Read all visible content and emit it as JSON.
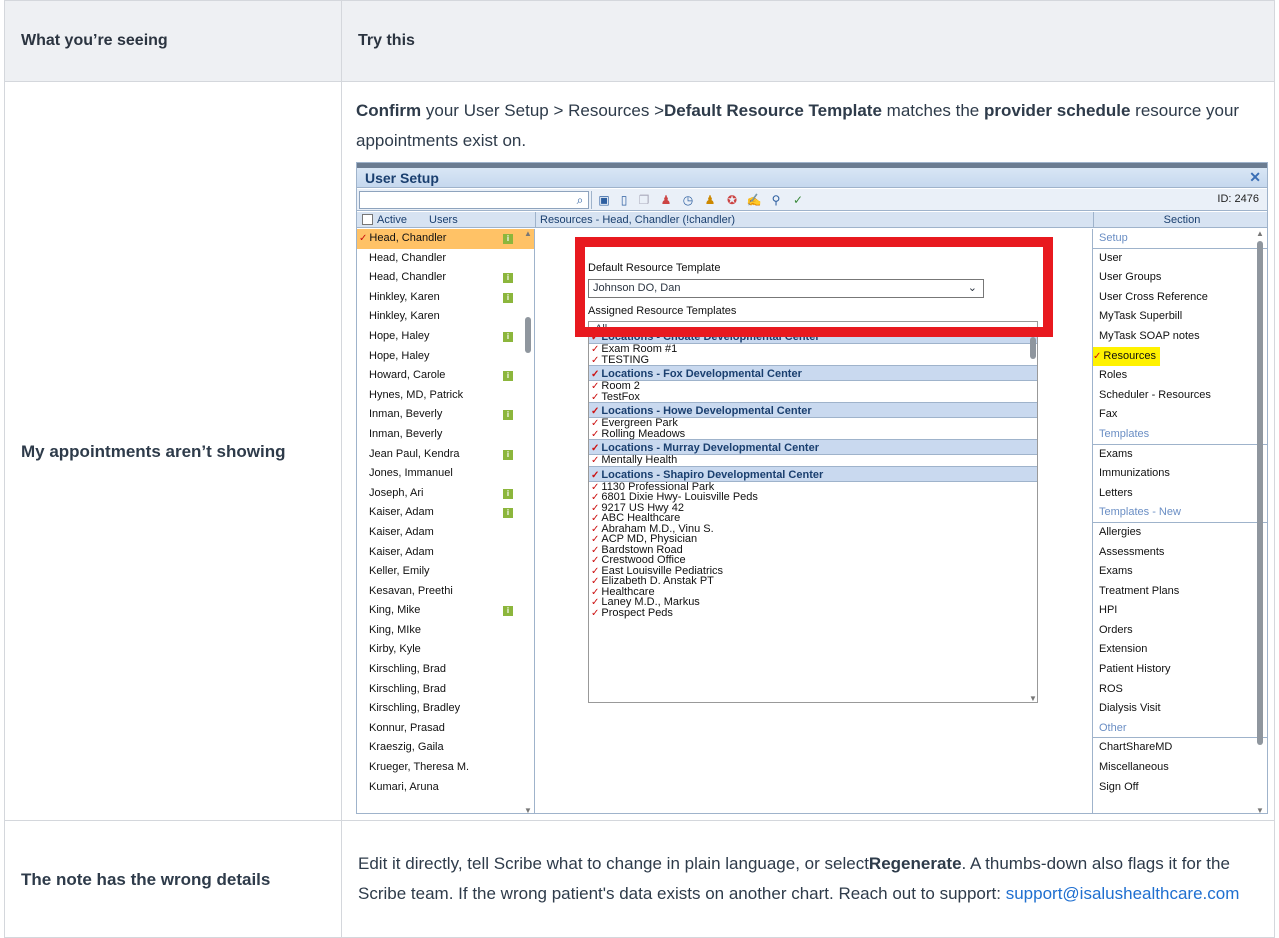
{
  "table": {
    "header_left": "What you’re seeing",
    "header_right": "Try this"
  },
  "row1": {
    "left": "My appointments aren’t showing",
    "right_parts": {
      "p1": "Confirm",
      "p2": " your User Setup > Resources >",
      "p3": "Default Resource Template",
      "p4": " matches the ",
      "p5": "provider schedule",
      "p6": " resource your appointments exist on."
    }
  },
  "row2": {
    "left": "The note has the wrong details",
    "p1": "Edit it directly, tell Scribe what to change in plain language, or select",
    "p2": "Regenerate",
    "p3": ". A thumbs-down also flags it for the Scribe team. If the wrong patient's data exists on another chart. Reach out to support: ",
    "link": "support@isalushealthcare.com"
  },
  "app": {
    "title": "User Setup",
    "id_label": "ID: 2476",
    "col_active": "Active",
    "col_users": "Users",
    "col_resources": "Resources - Head, Chandler (!chandler)",
    "col_section": "Section",
    "default_label": "Default Resource Template",
    "default_value": "Johnson DO, Dan",
    "assigned_label": "Assigned Resource Templates",
    "assigned_value": "All",
    "users": [
      {
        "name": "Head, Chandler",
        "info": true,
        "selected": true
      },
      {
        "name": "Head, Chandler",
        "info": false
      },
      {
        "name": "Head, Chandler",
        "info": true
      },
      {
        "name": "Hinkley, Karen",
        "info": true
      },
      {
        "name": "Hinkley, Karen",
        "info": false
      },
      {
        "name": "Hope, Haley",
        "info": true
      },
      {
        "name": "Hope, Haley",
        "info": false
      },
      {
        "name": "Howard, Carole",
        "info": true
      },
      {
        "name": "Hynes, MD, Patrick",
        "info": false
      },
      {
        "name": "Inman, Beverly",
        "info": true
      },
      {
        "name": "Inman, Beverly",
        "info": false
      },
      {
        "name": "Jean Paul, Kendra",
        "info": true
      },
      {
        "name": "Jones, Immanuel",
        "info": false
      },
      {
        "name": "Joseph, Ari",
        "info": true
      },
      {
        "name": "Kaiser, Adam",
        "info": true
      },
      {
        "name": "Kaiser, Adam",
        "info": false
      },
      {
        "name": "Kaiser, Adam",
        "info": false
      },
      {
        "name": "Keller, Emily",
        "info": false
      },
      {
        "name": "Kesavan, Preethi",
        "info": false
      },
      {
        "name": "King, Mike",
        "info": true
      },
      {
        "name": "King, MIke",
        "info": false
      },
      {
        "name": "Kirby, Kyle",
        "info": false
      },
      {
        "name": "Kirschling, Brad",
        "info": false
      },
      {
        "name": "Kirschling, Brad",
        "info": false
      },
      {
        "name": "Kirschling, Bradley",
        "info": false
      },
      {
        "name": "Konnur, Prasad",
        "info": false
      },
      {
        "name": "Kraeszig, Gaila",
        "info": false
      },
      {
        "name": "Krueger, Theresa M.",
        "info": false
      },
      {
        "name": "Kumari, Aruna",
        "info": false
      }
    ],
    "resources": [
      {
        "t": "grp",
        "text": "Locations - Choate Developmental Center"
      },
      {
        "t": "it",
        "text": "Exam Room #1"
      },
      {
        "t": "it",
        "text": "TESTING"
      },
      {
        "t": "grp",
        "text": "Locations - Fox Developmental Center"
      },
      {
        "t": "it",
        "text": "Room 2"
      },
      {
        "t": "it",
        "text": "TestFox"
      },
      {
        "t": "grp",
        "text": "Locations - Howe Developmental Center"
      },
      {
        "t": "it",
        "text": "Evergreen Park"
      },
      {
        "t": "it",
        "text": "Rolling Meadows"
      },
      {
        "t": "grp",
        "text": "Locations - Murray Developmental Center"
      },
      {
        "t": "it",
        "text": "Mentally Health"
      },
      {
        "t": "grp",
        "text": "Locations - Shapiro Developmental Center"
      },
      {
        "t": "it",
        "text": "1130 Professional Park"
      },
      {
        "t": "it",
        "text": "6801 Dixie Hwy- Louisville Peds"
      },
      {
        "t": "it",
        "text": "9217 US Hwy 42"
      },
      {
        "t": "it",
        "text": "ABC Healthcare"
      },
      {
        "t": "it",
        "text": "Abraham M.D., Vinu S."
      },
      {
        "t": "it",
        "text": "ACP MD, Physician"
      },
      {
        "t": "it",
        "text": "Bardstown Road"
      },
      {
        "t": "it",
        "text": "Crestwood Office"
      },
      {
        "t": "it",
        "text": "East Louisville Pediatrics"
      },
      {
        "t": "it",
        "text": "Elizabeth D. Anstak PT"
      },
      {
        "t": "it",
        "text": "Healthcare"
      },
      {
        "t": "it",
        "text": "Laney M.D., Markus"
      },
      {
        "t": "it",
        "text": "Prospect Peds"
      }
    ],
    "sections": [
      {
        "t": "h",
        "text": "Setup"
      },
      {
        "t": "s",
        "text": "User"
      },
      {
        "t": "s",
        "text": "User Groups"
      },
      {
        "t": "s",
        "text": "User Cross Reference"
      },
      {
        "t": "s",
        "text": "MyTask Superbill"
      },
      {
        "t": "s",
        "text": "MyTask SOAP notes"
      },
      {
        "t": "sel",
        "text": "Resources"
      },
      {
        "t": "s",
        "text": "Roles"
      },
      {
        "t": "s",
        "text": "Scheduler - Resources"
      },
      {
        "t": "s",
        "text": "Fax"
      },
      {
        "t": "h",
        "text": "Templates"
      },
      {
        "t": "s",
        "text": "Exams"
      },
      {
        "t": "s",
        "text": "Immunizations"
      },
      {
        "t": "s",
        "text": "Letters"
      },
      {
        "t": "h",
        "text": "Templates - New"
      },
      {
        "t": "s",
        "text": "Allergies"
      },
      {
        "t": "s",
        "text": "Assessments"
      },
      {
        "t": "s",
        "text": "Exams"
      },
      {
        "t": "s",
        "text": "Treatment Plans"
      },
      {
        "t": "s",
        "text": "HPI"
      },
      {
        "t": "s",
        "text": "Orders"
      },
      {
        "t": "s",
        "text": "Extension"
      },
      {
        "t": "s",
        "text": "Patient History"
      },
      {
        "t": "s",
        "text": "ROS"
      },
      {
        "t": "s",
        "text": "Dialysis Visit"
      },
      {
        "t": "h",
        "text": "Other"
      },
      {
        "t": "s",
        "text": "ChartShareMD"
      },
      {
        "t": "s",
        "text": "Miscellaneous"
      },
      {
        "t": "s",
        "text": "Sign Off"
      }
    ]
  },
  "colors": {
    "accent_red": "#e8191f",
    "highlight_yellow": "#fff200",
    "selected_row": "#ffc266",
    "link_blue": "#1f6fd0"
  }
}
